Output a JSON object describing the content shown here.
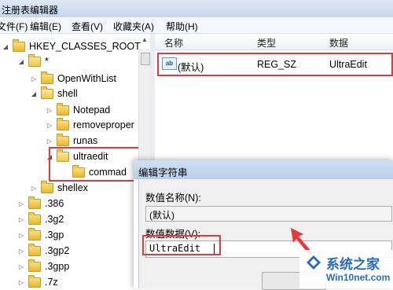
{
  "window": {
    "title": "注册表编辑器"
  },
  "menu": [
    "文件(F)",
    "编辑(E)",
    "查看(V)",
    "收藏夹(A)",
    "帮助(H)"
  ],
  "tree": {
    "root": "HKEY_CLASSES_ROOT",
    "star": "*",
    "openwithlist": "OpenWithList",
    "shell": "shell",
    "notepad": "Notepad",
    "removeproper": "removeproper",
    "runas": "runas",
    "ultraedit": "ultraedit",
    "commad": "commad",
    "shellex": "shellex",
    "ext386": ".386",
    "ext3g2": ".3g2",
    "ext3gp": ".3gp",
    "ext3gp2": ".3gp2",
    "ext3gpp": ".3gpp",
    "ext7z": ".7z"
  },
  "list": {
    "headers": {
      "name": "名称",
      "type": "类型",
      "data": "数据"
    },
    "row": {
      "icon": "ab",
      "name": "(默认)",
      "type": "REG_SZ",
      "data": "UltraEdit"
    }
  },
  "dialog": {
    "title": "编辑字符串",
    "name_label": "数值名称(N):",
    "name_value": "(默认)",
    "data_label": "数值数据(V):",
    "data_value": "UltraEdit"
  },
  "watermark": {
    "brand": "系统之家",
    "site": "Win10net.com"
  },
  "colors": {
    "highlight_box": "#e23b3b",
    "folder": "#f0c84e",
    "watermark": "#2a6cb8"
  }
}
